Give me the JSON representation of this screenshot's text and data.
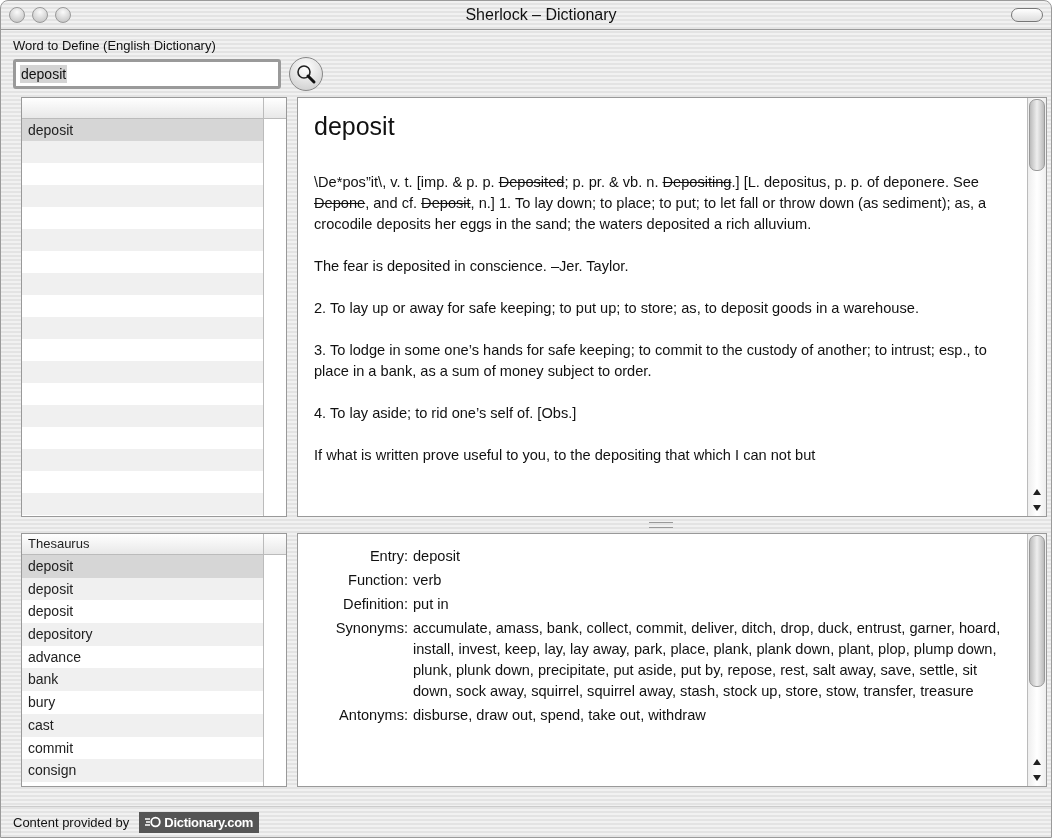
{
  "window": {
    "title": "Sherlock – Dictionary"
  },
  "search": {
    "label": "Word to Define (English Dictionary)",
    "value": "deposit"
  },
  "word_list": {
    "items": [
      {
        "label": "deposit",
        "selected": true
      }
    ]
  },
  "definition": {
    "headword": "deposit",
    "paragraphs": [
      [
        {
          "text": "\\De*pos”it\\, v. t. [imp. & p. p. ",
          "strike": false
        },
        {
          "text": "Deposited",
          "strike": true
        },
        {
          "text": "; p. pr. & vb. n. ",
          "strike": false
        },
        {
          "text": "Depositing",
          "strike": true
        },
        {
          "text": ".] [L. depositus, p. p. of deponere. See ",
          "strike": false
        },
        {
          "text": "Depone",
          "strike": true
        },
        {
          "text": ", and cf. ",
          "strike": false
        },
        {
          "text": "Deposit",
          "strike": true
        },
        {
          "text": ", n.] 1. To lay down; to place; to put; to let fall or throw down (as sediment); as, a crocodile deposits her eggs in the sand; the waters deposited a rich alluvium.",
          "strike": false
        }
      ],
      [
        {
          "text": "The fear is deposited in conscience. –Jer. Taylor.",
          "strike": false
        }
      ],
      [
        {
          "text": "2. To lay up or away for safe keeping; to put up; to store; as, to deposit goods in a warehouse.",
          "strike": false
        }
      ],
      [
        {
          "text": "3. To lodge in some one’s hands for safe keeping; to commit to the custody of another; to intrust; esp., to place in a bank, as a sum of money subject to order.",
          "strike": false
        }
      ],
      [
        {
          "text": "4. To lay aside; to rid one’s self of. [Obs.]",
          "strike": false
        }
      ],
      [
        {
          "text": "If what is written prove useful to you, to the depositing that which I can not but",
          "strike": false
        }
      ]
    ]
  },
  "thesaurus": {
    "header": "Thesaurus",
    "items": [
      {
        "label": "deposit",
        "selected": true
      },
      {
        "label": "deposit",
        "selected": false
      },
      {
        "label": "deposit",
        "selected": false
      },
      {
        "label": "depository",
        "selected": false
      },
      {
        "label": "advance",
        "selected": false
      },
      {
        "label": "bank",
        "selected": false
      },
      {
        "label": "bury",
        "selected": false
      },
      {
        "label": "cast",
        "selected": false
      },
      {
        "label": "commit",
        "selected": false
      },
      {
        "label": "consign",
        "selected": false
      }
    ]
  },
  "entry": {
    "fields": [
      {
        "label": "Entry:",
        "value": "deposit"
      },
      {
        "label": "Function:",
        "value": "verb"
      },
      {
        "label": "Definition:",
        "value": "put in"
      },
      {
        "label": "Synonyms:",
        "value": "accumulate, amass, bank, collect, commit, deliver, ditch, drop, duck, entrust, garner, hoard, install, invest, keep, lay, lay away, park, place, plank, plank down, plant, plop, plump down, plunk, plunk down, precipitate, put aside, put by, repose, rest, salt away, save, settle, sit down, sock away, squirrel, squirrel away, stash, stock up, store, stow, transfer, treasure"
      },
      {
        "label": "Antonyms:",
        "value": "disburse, draw out, spend, take out, withdraw"
      }
    ]
  },
  "footer": {
    "text": "Content provided by",
    "logo": "Dictionary.com"
  }
}
